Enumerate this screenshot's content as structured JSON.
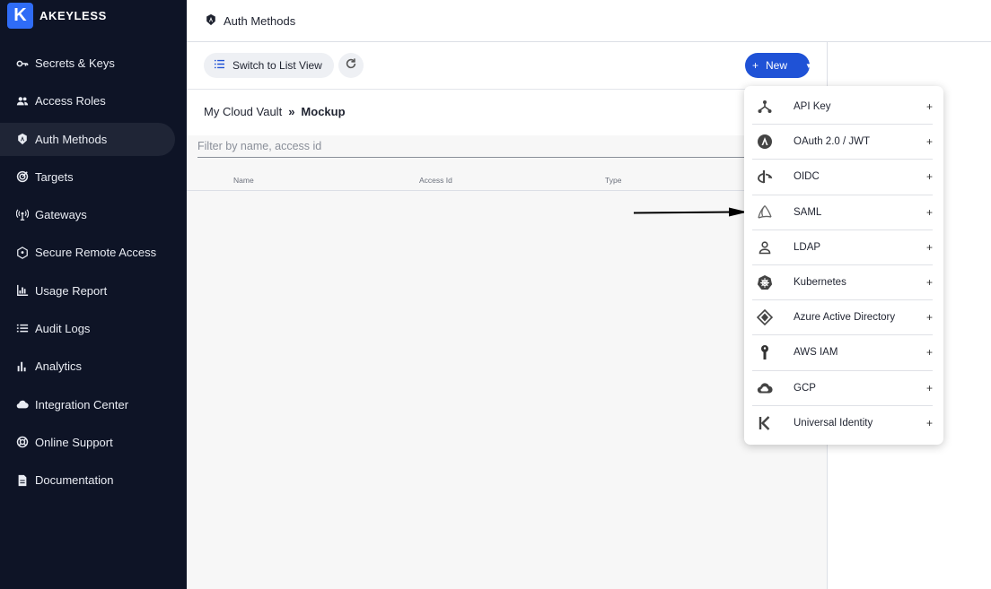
{
  "brand": {
    "logo_letter": "K",
    "name": "AKEYLESS"
  },
  "sidebar": {
    "items": [
      {
        "label": "Secrets & Keys",
        "icon": "key-icon"
      },
      {
        "label": "Access Roles",
        "icon": "users-icon"
      },
      {
        "label": "Auth Methods",
        "icon": "auth-methods-icon",
        "active": true
      },
      {
        "label": "Targets",
        "icon": "target-icon"
      },
      {
        "label": "Gateways",
        "icon": "gateway-icon"
      },
      {
        "label": "Secure Remote Access",
        "icon": "shield-icon"
      },
      {
        "label": "Usage Report",
        "icon": "usage-report-icon"
      },
      {
        "label": "Audit Logs",
        "icon": "list-icon"
      },
      {
        "label": "Analytics",
        "icon": "bar-chart-icon"
      },
      {
        "label": "Integration Center",
        "icon": "cloud-icon"
      },
      {
        "label": "Online Support",
        "icon": "support-icon"
      },
      {
        "label": "Documentation",
        "icon": "document-icon"
      }
    ]
  },
  "header": {
    "title": "Auth Methods"
  },
  "toolbar": {
    "list_view_label": "Switch to List View",
    "new_label": "New"
  },
  "breadcrumb": {
    "parent": "My Cloud Vault",
    "separator": "»",
    "current": "Mockup"
  },
  "filter": {
    "placeholder": "Filter by name, access id",
    "value": ""
  },
  "table": {
    "columns": [
      "Name",
      "Access Id",
      "Type"
    ]
  },
  "new_menu": {
    "items": [
      {
        "label": "API Key",
        "icon": "api-key-icon"
      },
      {
        "label": "OAuth 2.0 / JWT",
        "icon": "oauth-icon"
      },
      {
        "label": "OIDC",
        "icon": "oidc-icon"
      },
      {
        "label": "SAML",
        "icon": "saml-icon"
      },
      {
        "label": "LDAP",
        "icon": "ldap-user-icon"
      },
      {
        "label": "Kubernetes",
        "icon": "kubernetes-icon"
      },
      {
        "label": "Azure Active Directory",
        "icon": "azure-icon"
      },
      {
        "label": "AWS IAM",
        "icon": "aws-iam-icon"
      },
      {
        "label": "GCP",
        "icon": "gcp-cloud-icon"
      },
      {
        "label": "Universal Identity",
        "icon": "universal-identity-icon"
      }
    ],
    "add_symbol": "+"
  },
  "colors": {
    "sidebar_bg": "#0e1426",
    "accent": "#1f52d6",
    "brand": "#2f6cf6"
  }
}
